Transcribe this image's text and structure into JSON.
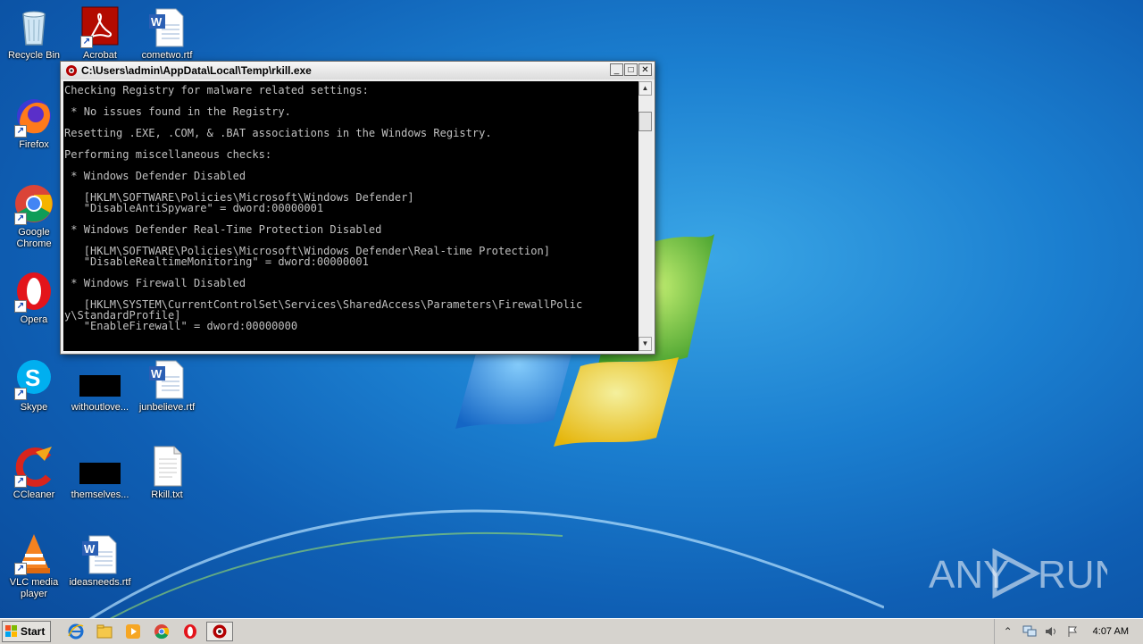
{
  "desktop": {
    "icons": [
      {
        "label": "Recycle Bin",
        "icon": "recycle-bin-icon"
      },
      {
        "label": "Acrobat",
        "icon": "acrobat-icon"
      },
      {
        "label": "cometwo.rtf",
        "icon": "word-document-icon"
      },
      {
        "label": "Firefox",
        "icon": "firefox-icon"
      },
      {
        "label": "Google Chrome",
        "icon": "chrome-icon"
      },
      {
        "label": "Opera",
        "icon": "opera-icon"
      },
      {
        "label": "Skype",
        "icon": "skype-icon"
      },
      {
        "label": "withoutlove...",
        "icon": "black-file-icon"
      },
      {
        "label": "junbelieve.rtf",
        "icon": "word-document-icon"
      },
      {
        "label": "CCleaner",
        "icon": "ccleaner-icon"
      },
      {
        "label": "themselves...",
        "icon": "black-file-icon"
      },
      {
        "label": "Rkill.txt",
        "icon": "text-file-icon"
      },
      {
        "label": "VLC media player",
        "icon": "vlc-icon"
      },
      {
        "label": "ideasneeds.rtf",
        "icon": "word-document-icon"
      }
    ],
    "watermark": "ANY RUN"
  },
  "window": {
    "title": "C:\\Users\\admin\\AppData\\Local\\Temp\\rkill.exe",
    "console_text": "Checking Registry for malware related settings:\n\n * No issues found in the Registry.\n\nResetting .EXE, .COM, & .BAT associations in the Windows Registry.\n\nPerforming miscellaneous checks:\n\n * Windows Defender Disabled\n\n   [HKLM\\SOFTWARE\\Policies\\Microsoft\\Windows Defender]\n   \"DisableAntiSpyware\" = dword:00000001\n\n * Windows Defender Real-Time Protection Disabled\n\n   [HKLM\\SOFTWARE\\Policies\\Microsoft\\Windows Defender\\Real-time Protection]\n   \"DisableRealtimeMonitoring\" = dword:00000001\n\n * Windows Firewall Disabled\n\n   [HKLM\\SYSTEM\\CurrentControlSet\\Services\\SharedAccess\\Parameters\\FirewallPolic\ny\\StandardProfile]\n   \"EnableFirewall\" = dword:00000000\n\n_",
    "buttons": {
      "minimize": "_",
      "maximize": "□",
      "close": "✕"
    }
  },
  "taskbar": {
    "start_label": "Start",
    "clock": "4:07 AM"
  }
}
